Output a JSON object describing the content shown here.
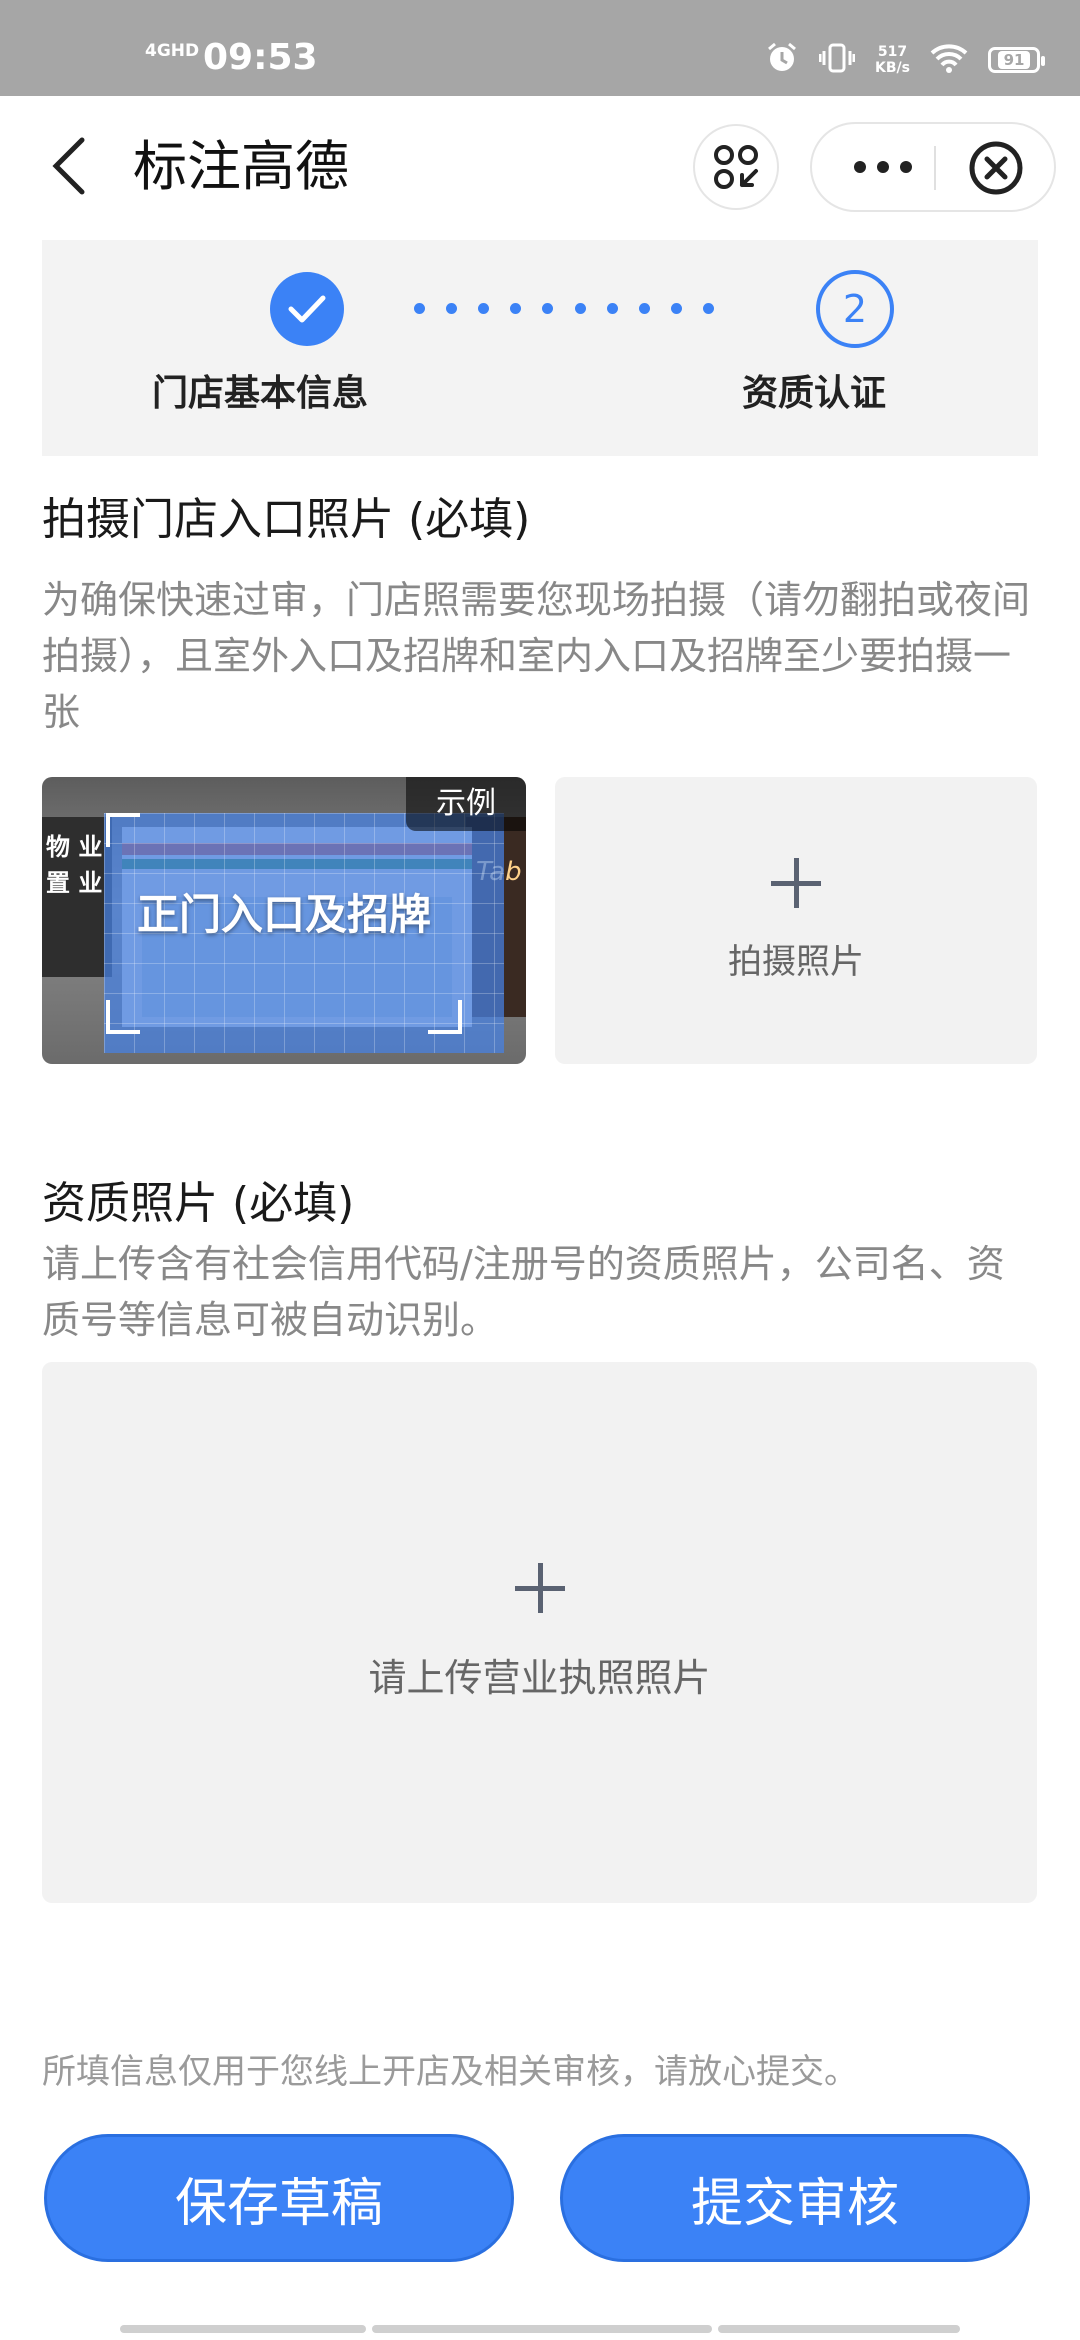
{
  "status_bar": {
    "network": "4GHD",
    "time": "09:53",
    "speed_value": "517",
    "speed_unit": "KB/s",
    "battery": "91"
  },
  "nav": {
    "title": "标注高德"
  },
  "steps": [
    {
      "label": "门店基本信息",
      "state": "done"
    },
    {
      "label": "资质认证",
      "number": "2",
      "state": "current"
    }
  ],
  "store_photo": {
    "title": "拍摄门店入口照片 (必填)",
    "description": "为确保快速过审，门店照需要您现场拍摄（请勿翻拍或夜间拍摄），且室外入口及招牌和室内入口及招牌至少要拍摄一张",
    "example_badge": "示例",
    "example_caption": "正门入口及招牌",
    "example_sign_left_1": "物 业",
    "example_sign_left_2": "置 业",
    "example_sign_right": "Tab",
    "upload_label": "拍摄照片"
  },
  "license_photo": {
    "title": "资质照片 (必填)",
    "description": "请上传含有社会信用代码/注册号的资质照片，公司名、资质号等信息可被自动识别。",
    "upload_label": "请上传营业执照照片"
  },
  "notice": "所填信息仅用于您线上开店及相关审核，请放心提交。",
  "buttons": {
    "draft": "保存草稿",
    "submit": "提交审核"
  },
  "colors": {
    "accent": "#3b82f6",
    "status_bar": "#a6a6a6",
    "upload_bg": "#f2f2f2"
  }
}
